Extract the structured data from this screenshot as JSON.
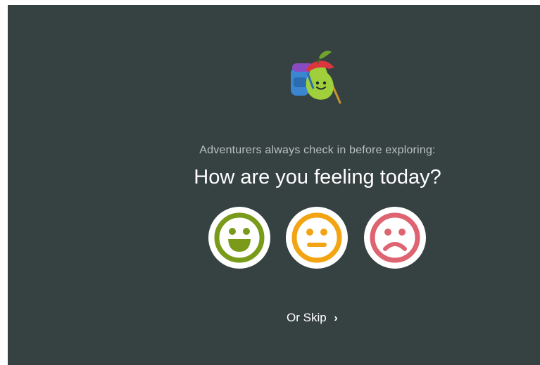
{
  "checkin": {
    "subtitle": "Adventurers always check in before exploring:",
    "question": "How are you feeling today?",
    "skip_label": "Or Skip",
    "skip_chevron": "›"
  },
  "mascot": {
    "icon": "pear-explorer-mascot-icon"
  },
  "moods": [
    {
      "icon": "happy-face-icon",
      "color": "#7a9a1a"
    },
    {
      "icon": "neutral-face-icon",
      "color": "#f2a413"
    },
    {
      "icon": "sad-face-icon",
      "color": "#dd6470"
    }
  ],
  "colors": {
    "background": "#364142",
    "subtitle": "#b9c1c0",
    "question": "#ffffff"
  }
}
